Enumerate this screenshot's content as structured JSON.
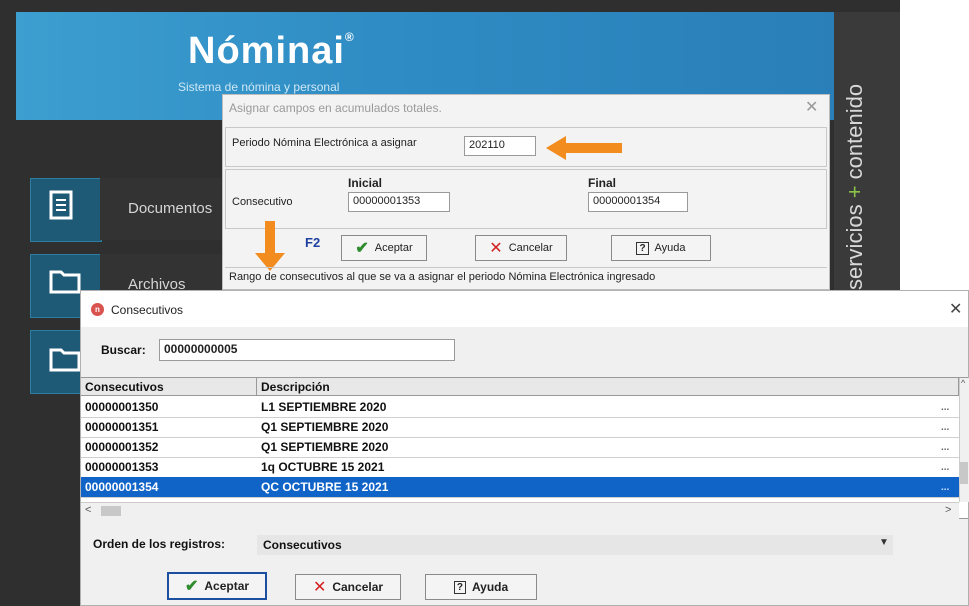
{
  "app": {
    "title": "Nóminai",
    "subtitle": "Sistema de nómina y personal",
    "side_text_a": "servicios",
    "side_text_plus": "+",
    "side_text_b": "contenido",
    "side_items": [
      {
        "label": "Documentos",
        "icon": "document-icon"
      },
      {
        "label": "Archivos",
        "icon": "folder-icon"
      },
      {
        "label": "",
        "icon": "folder-open-icon"
      }
    ]
  },
  "dialog1": {
    "title": "Asignar campos en acumulados totales.",
    "period_label": "Periodo Nómina Electrónica a asignar",
    "period_value": "202110",
    "consecutivo_label": "Consecutivo",
    "inicial_label": "Inicial",
    "inicial_value": "00000001353",
    "final_label": "Final",
    "final_value": "00000001354",
    "f2_label": "F2",
    "accept_label": "Aceptar",
    "cancel_label": "Cancelar",
    "help_label": "Ayuda",
    "help_icon_text": "?",
    "footer_text": "Rango de consecutivos al que se va a asignar el periodo Nómina Electrónica ingresado"
  },
  "dialog2": {
    "title": "Consecutivos",
    "search_label": "Buscar:",
    "search_value": "00000000005",
    "columns": [
      "Consecutivos",
      "Descripción"
    ],
    "rows": [
      {
        "consecutivo": "00000001350",
        "descripcion": "L1 SEPTIEMBRE 2020"
      },
      {
        "consecutivo": "00000001351",
        "descripcion": "Q1 SEPTIEMBRE 2020"
      },
      {
        "consecutivo": "00000001352",
        "descripcion": "Q1 SEPTIEMBRE 2020"
      },
      {
        "consecutivo": "00000001353",
        "descripcion": "1q OCTUBRE 15 2021"
      },
      {
        "consecutivo": "00000001354",
        "descripcion": "QC OCTUBRE 15 2021"
      }
    ],
    "row_dots": "...",
    "order_label": "Orden de los registros:",
    "order_value": "Consecutivos",
    "accept_label": "Aceptar",
    "cancel_label": "Cancelar",
    "help_label": "Ayuda",
    "help_icon_text": "?"
  },
  "colors": {
    "accent_orange": "#f28c1e",
    "selection_blue": "#1064c8",
    "header_blue": "#2f8cc4"
  }
}
